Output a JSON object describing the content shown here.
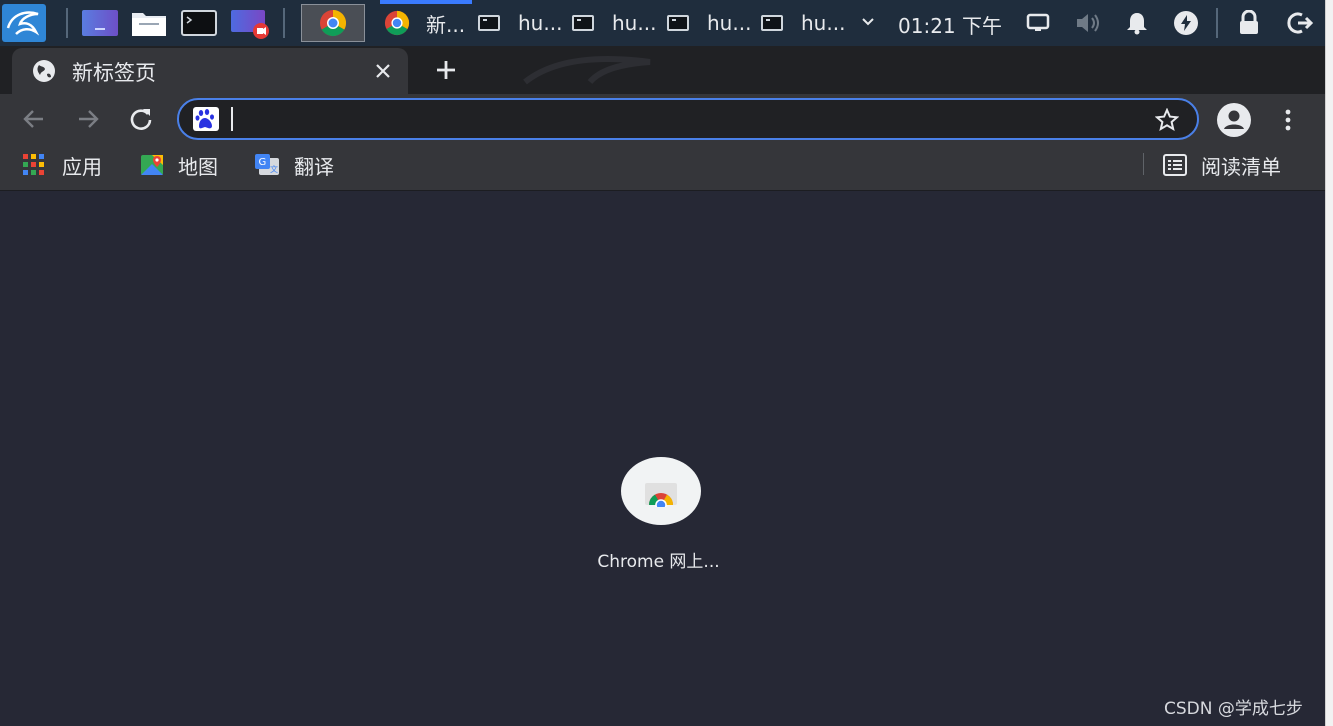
{
  "colors": {
    "taskbar_bg": "#1f2d3d",
    "tabstrip_bg": "#202124",
    "toolbar_bg": "#35363a",
    "content_bg": "#262835",
    "omnibox_border": "#4a80e8",
    "active_task_indicator": "#3a7bff"
  },
  "taskbar": {
    "launchers": [
      {
        "name": "kali-menu-icon"
      },
      {
        "name": "workspace-icon"
      },
      {
        "name": "file-manager-icon"
      },
      {
        "name": "terminal-icon"
      },
      {
        "name": "screen-recorder-icon"
      }
    ],
    "tasks": [
      {
        "icon": "chrome-icon",
        "label": "新..."
      },
      {
        "icon": "terminal-icon",
        "label": "hu..."
      },
      {
        "icon": "terminal-icon",
        "label": "hu..."
      },
      {
        "icon": "terminal-icon",
        "label": "hu..."
      },
      {
        "icon": "terminal-icon",
        "label": "hu..."
      }
    ],
    "clock": "01:21 下午"
  },
  "browser": {
    "tab": {
      "title": "新标签页"
    },
    "address": {
      "value": "",
      "placeholder": ""
    },
    "bookmarks": [
      {
        "icon": "apps-grid-icon",
        "label": "应用"
      },
      {
        "icon": "maps-icon",
        "label": "地图"
      },
      {
        "icon": "translate-icon",
        "label": "翻译"
      }
    ],
    "reading_list": "阅读清单",
    "shortcut": {
      "label": "Chrome 网上..."
    }
  },
  "watermark": "CSDN @学成七步"
}
